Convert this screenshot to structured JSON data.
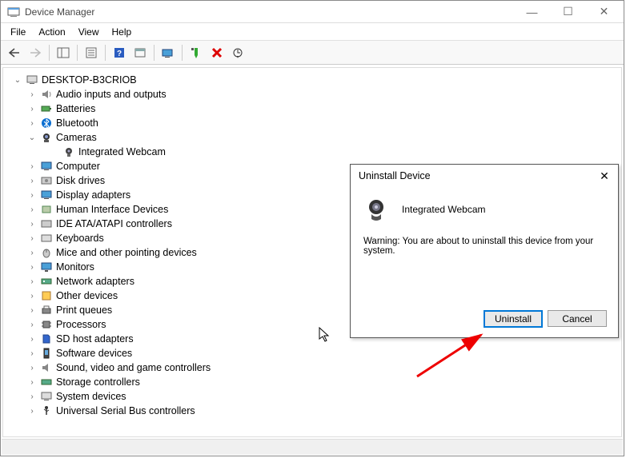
{
  "window": {
    "title": "Device Manager"
  },
  "menu": {
    "file": "File",
    "action": "Action",
    "view": "View",
    "help": "Help"
  },
  "tree": {
    "root": "DESKTOP-B3CRIOB",
    "nodes": [
      {
        "label": "Audio inputs and outputs"
      },
      {
        "label": "Batteries"
      },
      {
        "label": "Bluetooth"
      },
      {
        "label": "Cameras",
        "expanded": true,
        "children": [
          {
            "label": "Integrated Webcam"
          }
        ]
      },
      {
        "label": "Computer"
      },
      {
        "label": "Disk drives"
      },
      {
        "label": "Display adapters"
      },
      {
        "label": "Human Interface Devices"
      },
      {
        "label": "IDE ATA/ATAPI controllers"
      },
      {
        "label": "Keyboards"
      },
      {
        "label": "Mice and other pointing devices"
      },
      {
        "label": "Monitors"
      },
      {
        "label": "Network adapters"
      },
      {
        "label": "Other devices"
      },
      {
        "label": "Print queues"
      },
      {
        "label": "Processors"
      },
      {
        "label": "SD host adapters"
      },
      {
        "label": "Software devices"
      },
      {
        "label": "Sound, video and game controllers"
      },
      {
        "label": "Storage controllers"
      },
      {
        "label": "System devices"
      },
      {
        "label": "Universal Serial Bus controllers"
      }
    ]
  },
  "dialog": {
    "title": "Uninstall Device",
    "device": "Integrated Webcam",
    "warning": "Warning: You are about to uninstall this device from your system.",
    "uninstall": "Uninstall",
    "cancel": "Cancel"
  }
}
